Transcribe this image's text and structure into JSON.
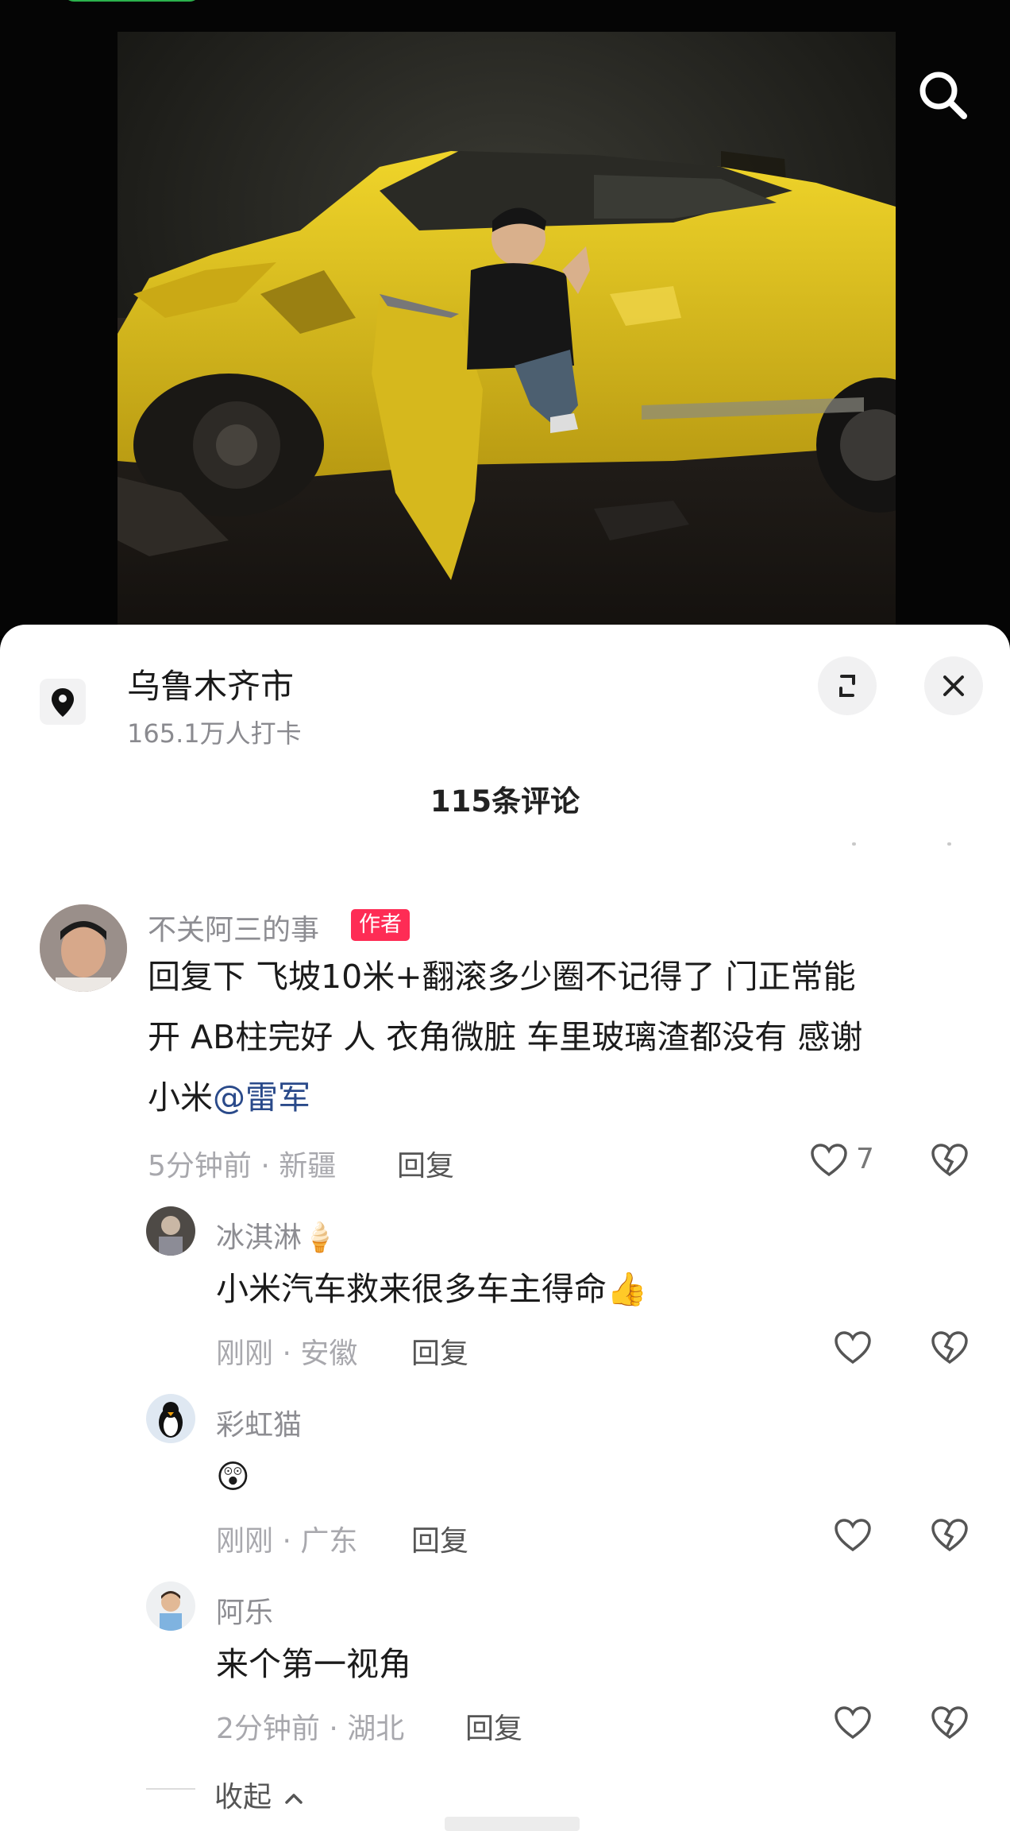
{
  "location": {
    "title": "乌鲁木齐市",
    "checkins": "165.1万人打卡"
  },
  "comments_header": "115条评论",
  "comments": [
    {
      "user": "不关阿三的事",
      "badge": "作者",
      "line1": "回复下 飞坡10米+翻滚多少圈不记得了 门正常能",
      "line2": "开 AB柱完好 人 衣角微脏 车里玻璃渣都没有 感谢",
      "line3_prefix": "小米",
      "mention": "@雷军",
      "meta": "5分钟前 · 新疆",
      "reply": "回复",
      "likes": "7"
    },
    {
      "user": "冰淇淋🍦",
      "text": "小米汽车救来很多车主得命👍",
      "meta": "刚刚 · 安徽",
      "reply": "回复"
    },
    {
      "user": "彩虹猫",
      "text": "😲",
      "meta": "刚刚 · 广东",
      "reply": "回复"
    },
    {
      "user": "阿乐",
      "text": "来个第一视角",
      "meta": "2分钟前 · 湖北",
      "reply": "回复"
    }
  ],
  "collapse_label": "收起",
  "colors": {
    "accent": "#fe2c55",
    "mention": "#2a4a8a",
    "car_yellow": "#e2c21a"
  },
  "icons": [
    "search-icon",
    "location-pin-icon",
    "expand-icon",
    "close-icon",
    "heart-icon",
    "dislike-icon",
    "chevron-up-icon"
  ]
}
